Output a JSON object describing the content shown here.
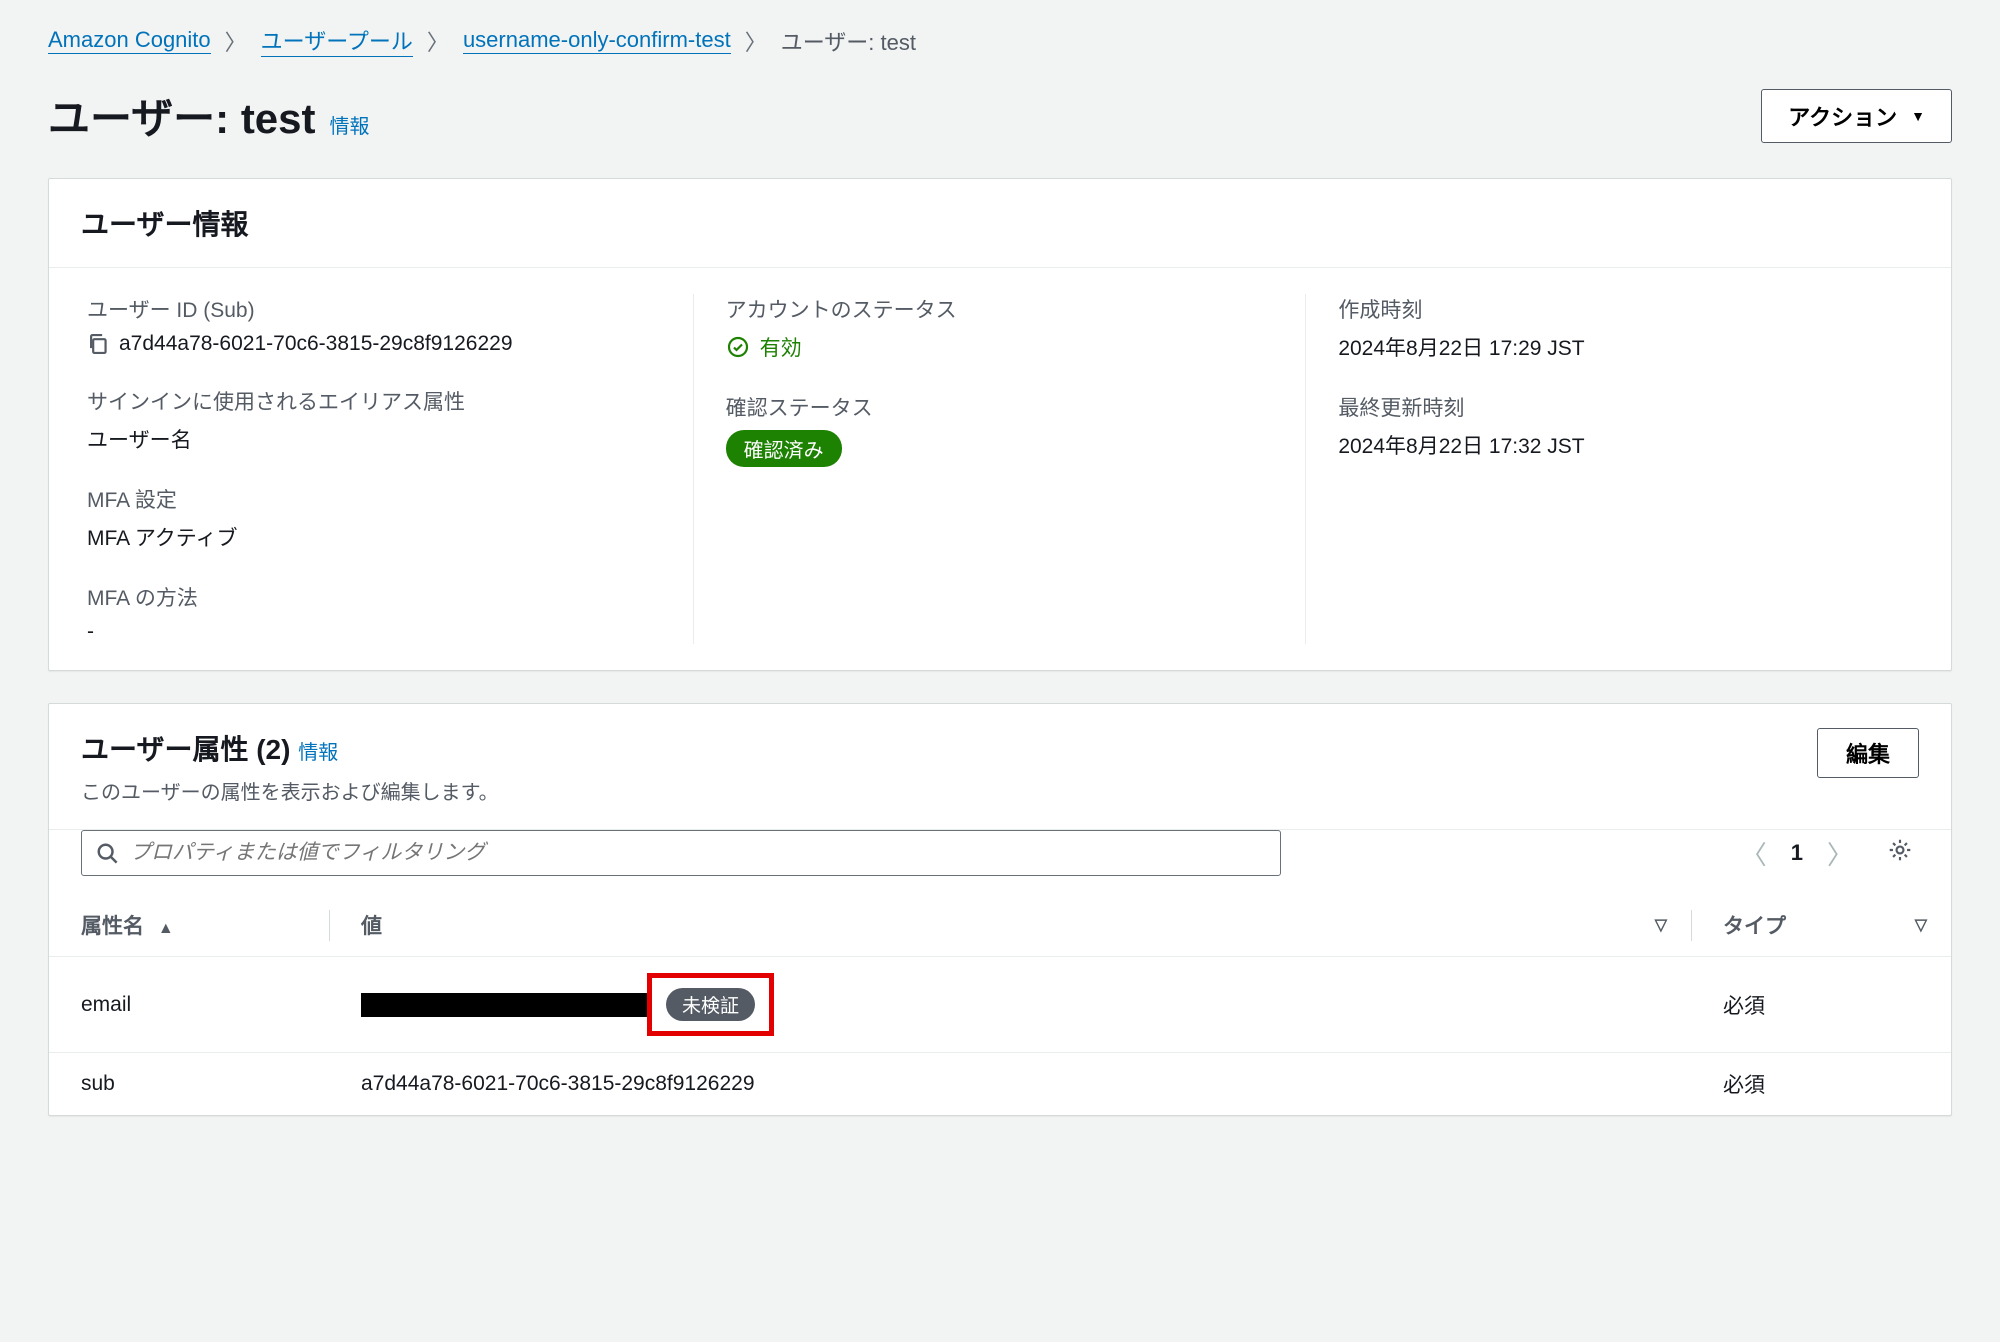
{
  "breadcrumbs": {
    "items": [
      {
        "label": "Amazon Cognito"
      },
      {
        "label": "ユーザープール"
      },
      {
        "label": "username-only-confirm-test"
      }
    ],
    "current": "ユーザー: test"
  },
  "header": {
    "title": "ユーザー: test",
    "info_link": "情報",
    "action_button": "アクション"
  },
  "user_info_panel": {
    "title": "ユーザー情報",
    "col1": {
      "user_id": {
        "label": "ユーザー ID (Sub)",
        "value": "a7d44a78-6021-70c6-3815-29c8f9126229"
      },
      "alias_attr": {
        "label": "サインインに使用されるエイリアス属性",
        "value": "ユーザー名"
      },
      "mfa_setting": {
        "label": "MFA 設定",
        "value": "MFA アクティブ"
      },
      "mfa_method": {
        "label": "MFA の方法",
        "value": "-"
      }
    },
    "col2": {
      "account_status": {
        "label": "アカウントのステータス",
        "value": "有効"
      },
      "confirm_status": {
        "label": "確認ステータス",
        "badge": "確認済み"
      }
    },
    "col3": {
      "created": {
        "label": "作成時刻",
        "value": "2024年8月22日 17:29 JST"
      },
      "updated": {
        "label": "最終更新時刻",
        "value": "2024年8月22日 17:32 JST"
      }
    }
  },
  "attributes_panel": {
    "title": "ユーザー属性 (2)",
    "info_link": "情報",
    "subtext": "このユーザーの属性を表示および編集します。",
    "edit_button": "編集",
    "filter_placeholder": "プロパティまたは値でフィルタリング",
    "page_number": "1",
    "columns": {
      "name": "属性名",
      "value": "値",
      "type": "タイプ"
    },
    "rows": [
      {
        "name": "email",
        "value_redacted": true,
        "badge": "未検証",
        "type": "必須"
      },
      {
        "name": "sub",
        "value": "a7d44a78-6021-70c6-3815-29c8f9126229",
        "type": "必須"
      }
    ]
  }
}
